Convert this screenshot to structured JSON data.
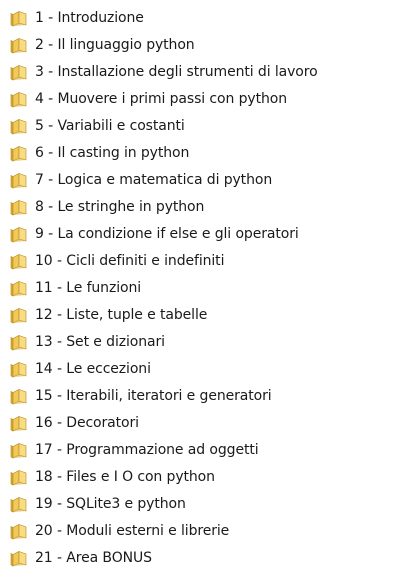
{
  "folders": [
    {
      "label": "1 - Introduzione",
      "icon": "folder-icon"
    },
    {
      "label": "2 - Il linguaggio python",
      "icon": "folder-icon"
    },
    {
      "label": "3 - Installazione degli strumenti di lavoro",
      "icon": "folder-icon"
    },
    {
      "label": "4 - Muovere i primi passi con python",
      "icon": "folder-icon"
    },
    {
      "label": "5 - Variabili e costanti",
      "icon": "folder-icon"
    },
    {
      "label": "6 - Il casting in python",
      "icon": "folder-icon"
    },
    {
      "label": "7 - Logica e matematica di python",
      "icon": "folder-icon"
    },
    {
      "label": "8 - Le stringhe in python",
      "icon": "folder-icon"
    },
    {
      "label": "9 - La condizione if else e gli operatori",
      "icon": "folder-icon"
    },
    {
      "label": "10 - Cicli definiti e indefiniti",
      "icon": "folder-icon"
    },
    {
      "label": "11 - Le funzioni",
      "icon": "folder-icon"
    },
    {
      "label": "12 - Liste, tuple e tabelle",
      "icon": "folder-icon"
    },
    {
      "label": "13 - Set e dizionari",
      "icon": "folder-icon"
    },
    {
      "label": "14 - Le eccezioni",
      "icon": "folder-icon"
    },
    {
      "label": "15 - Iterabili, iteratori e generatori",
      "icon": "folder-icon"
    },
    {
      "label": "16 - Decoratori",
      "icon": "folder-icon"
    },
    {
      "label": "17 - Programmazione ad oggetti",
      "icon": "folder-icon"
    },
    {
      "label": "18 - Files e I O con python",
      "icon": "folder-icon"
    },
    {
      "label": "19 - SQLite3 e python",
      "icon": "folder-icon"
    },
    {
      "label": "20 - Moduli esterni e librerie",
      "icon": "folder-icon"
    },
    {
      "label": "21 - Area BONUS",
      "icon": "folder-icon"
    }
  ],
  "colors": {
    "folder_body": "#f0c95a",
    "folder_back": "#d9a930",
    "folder_edge": "#b88a1c",
    "text": "#1a1a1a",
    "background": "#ffffff"
  }
}
